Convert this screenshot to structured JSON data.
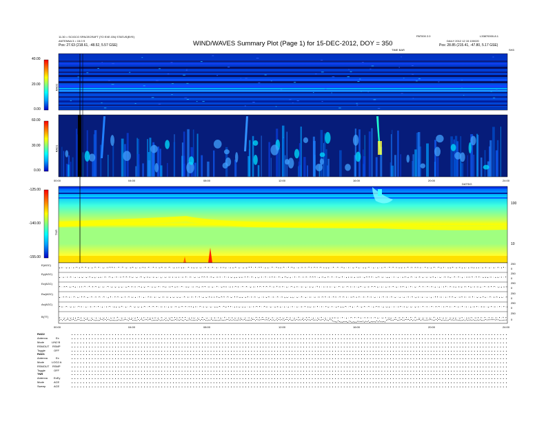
{
  "header": {
    "title": "WIND/WAVES Summary Plot (Page 1) for 15-DEC-2012, DOY = 350",
    "left_line1": "11.30 = SC/GCG SPACECRAFT (TO EXE.GN) STATUS(BYE)",
    "left_line2": "ANTENNA 3 = 15.0 S",
    "left_pos": "Pos:   27.63 (218.61, -48.52, 5.57 GSE)",
    "right_code": "PAT000 2.0",
    "right_ref": "L33870000-8.1",
    "right_line2": "DAILY  2012 12 15 100020",
    "right_pos": "Pos:   28.85 (215.41, -47.80, 5.17 GSE)",
    "right_timebar_label": "TIME BAR",
    "right_small": "SH3"
  },
  "chart_data": [
    {
      "type": "heatmap",
      "label": "RAD2",
      "ylim": [
        0,
        40
      ],
      "y_ticks": [
        "40.00",
        "20.00",
        "0.00"
      ],
      "colorbar": [
        "#0000c8",
        "#00a0ff",
        "#00ffff",
        "#80ff80",
        "#ffff00",
        "#ff8000",
        "#ff0000"
      ]
    },
    {
      "type": "heatmap",
      "label": "RAD1",
      "ylim": [
        0,
        60
      ],
      "y_ticks": [
        "60.00",
        "30.00",
        "0.00"
      ],
      "x_ticks": [
        "00:00",
        "04:00",
        "08:00",
        "12:00",
        "16:00",
        "20:00",
        "24:00"
      ],
      "x_right_label": "DATSIG"
    },
    {
      "type": "heatmap",
      "label": "TNR",
      "y_ticks": [
        "-125.00",
        "-140.00",
        "-155.00"
      ],
      "y_right_ticks": [
        "100",
        "10"
      ]
    },
    {
      "type": "line",
      "channels": [
        "E(AGC)",
        "Ey(AGC)",
        "Ez(AGC)",
        "Ew(AGC)",
        "Ax(AGC)",
        "B(TT)"
      ],
      "x_ticks": [
        "00:00",
        "04:00",
        "08:00",
        "12:00",
        "16:00",
        "20:00",
        "24:00"
      ],
      "y_right_ticks": [
        "250",
        "0",
        "250",
        "0",
        "250",
        "0",
        "250",
        "0",
        "250",
        "0",
        "250",
        "0"
      ]
    }
  ],
  "footer": {
    "rad2": [
      [
        "RAD2",
        ""
      ],
      [
        "Antenna",
        "Ex"
      ],
      [
        "Mode",
        "LIN2 B"
      ],
      [
        "RSMOUT",
        "RSMP"
      ],
      [
        "Toggle",
        "OFF"
      ]
    ],
    "rad1": [
      [
        "RAD1",
        ""
      ],
      [
        "Antenna",
        "Ex"
      ],
      [
        "Mode",
        "LOG2 A"
      ],
      [
        "RSMOUT",
        "RSMP"
      ],
      [
        "Toggle",
        "OFF"
      ]
    ],
    "tnr": [
      [
        "TNR",
        ""
      ],
      [
        "Antenna",
        "ExEy"
      ],
      [
        "Mode",
        "ACE"
      ],
      [
        "Sweep",
        "ACE"
      ]
    ]
  }
}
